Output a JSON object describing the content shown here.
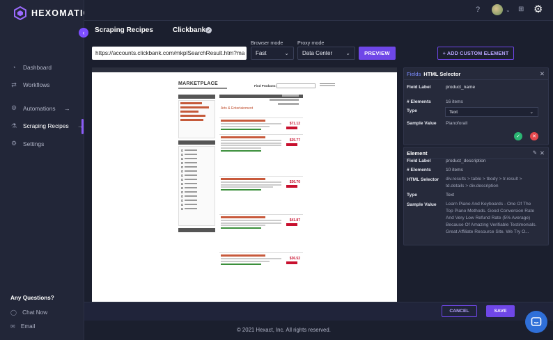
{
  "app": {
    "name": "HEXOMATIC"
  },
  "nav": [
    {
      "label": "Dashboard",
      "icon": "dashboard-icon"
    },
    {
      "label": "Workflows",
      "icon": "workflows-icon"
    },
    {
      "label": "Automations",
      "icon": "automations-icon"
    },
    {
      "label": "Scraping Recipes",
      "icon": "scraping-recipes-icon",
      "active": true
    },
    {
      "label": "Settings",
      "icon": "settings-icon"
    }
  ],
  "support": {
    "title": "Any Questions?",
    "chat": "Chat Now",
    "email": "Email"
  },
  "breadcrumb": {
    "section": "Scraping Recipes",
    "recipe": "Clickbank"
  },
  "toolbar": {
    "url": "https://accounts.clickbank.com/mkplSearchResult.htm?ma",
    "browser_mode_label": "Browser mode",
    "browser_mode_value": "Fast",
    "proxy_mode_label": "Proxy mode",
    "proxy_mode_value": "Data Center",
    "preview_label": "PREVIEW",
    "add_custom_label": "+ ADD CUSTOM ELEMENT"
  },
  "preview_page": {
    "marketplace_title": "MARKETPLACE",
    "find_products": "Find Products:",
    "category_title": "Arts & Entertainment",
    "prices": [
      "$71.12",
      "$25.77",
      "$36.70",
      "$41.87",
      "$36.52"
    ]
  },
  "panel_fields": {
    "tab": "Fields",
    "title": "HTML Selector",
    "field_label_key": "Field Label",
    "field_label_value": "product_name",
    "elements_key": "# Elements",
    "elements_value": "16 items",
    "type_key": "Type",
    "type_value": "Text",
    "sample_key": "Sample Value",
    "sample_value": "Pianoforall"
  },
  "panel_element": {
    "title": "Element",
    "field_label_key": "Field Label",
    "field_label_value": "product_description",
    "elements_key": "# Elements",
    "elements_value": "10 items",
    "selector_key": "HTML Selector",
    "selector_value": "div.results > table > tbody > tr.result > td.details > div.description",
    "type_key": "Type",
    "type_value": "Text",
    "sample_key": "Sample Value",
    "sample_value": "Learn Piano And Keyboards - One Of The Top Piano Methods. Good Conversion Rate And Very Low Refund Rate (5% Average) Because Of Amazing Verifiable Testimonials. Great Affiliate Resource Site. We Try O..."
  },
  "actions": {
    "cancel": "CANCEL",
    "save": "SAVE"
  },
  "footer": {
    "copyright": "© 2021 Hexact, Inc. All rights reserved."
  },
  "colors": {
    "accent": "#6f47e8",
    "bg": "#1b1f2e",
    "confirm": "#2bb673",
    "reject": "#e5484d"
  }
}
